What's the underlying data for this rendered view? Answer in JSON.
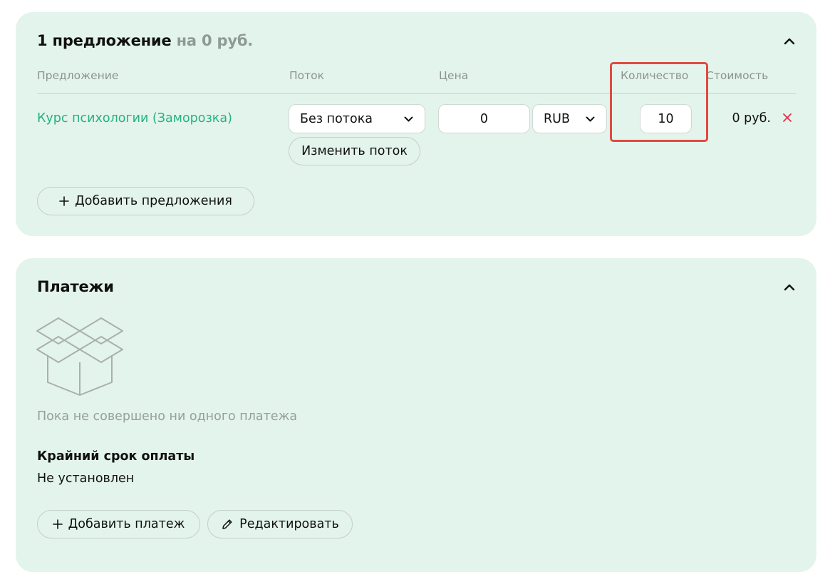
{
  "offers": {
    "count_label": "1 предложение",
    "total_label": "на 0 руб.",
    "columns": [
      "Предложение",
      "Поток",
      "Цена",
      "Количество",
      "Стоимость"
    ],
    "rows": [
      {
        "name": "Курс психологии (Заморозка)",
        "stream": "Без потока",
        "price": "0",
        "currency": "RUB",
        "quantity": "10",
        "cost": "0 руб."
      }
    ],
    "change_stream_label": "Изменить поток",
    "add_offers_label": "Добавить предложения"
  },
  "payments": {
    "title": "Платежи",
    "empty_text": "Пока не совершено ни одного платежа",
    "deadline_label": "Крайний срок оплаты",
    "deadline_value": "Не установлен",
    "add_payment_label": "Добавить платеж",
    "edit_label": "Редактировать"
  },
  "colors": {
    "panel_bg": "#e3f4ec",
    "accent_green": "#25b282",
    "remove_red": "#e0314b",
    "highlight_red": "#df4a40",
    "muted_text": "#8b948f"
  },
  "icons": [
    "chevron-up-icon",
    "chevron-down-icon",
    "close-icon",
    "plus-icon",
    "empty-box-icon",
    "pencil-icon"
  ]
}
